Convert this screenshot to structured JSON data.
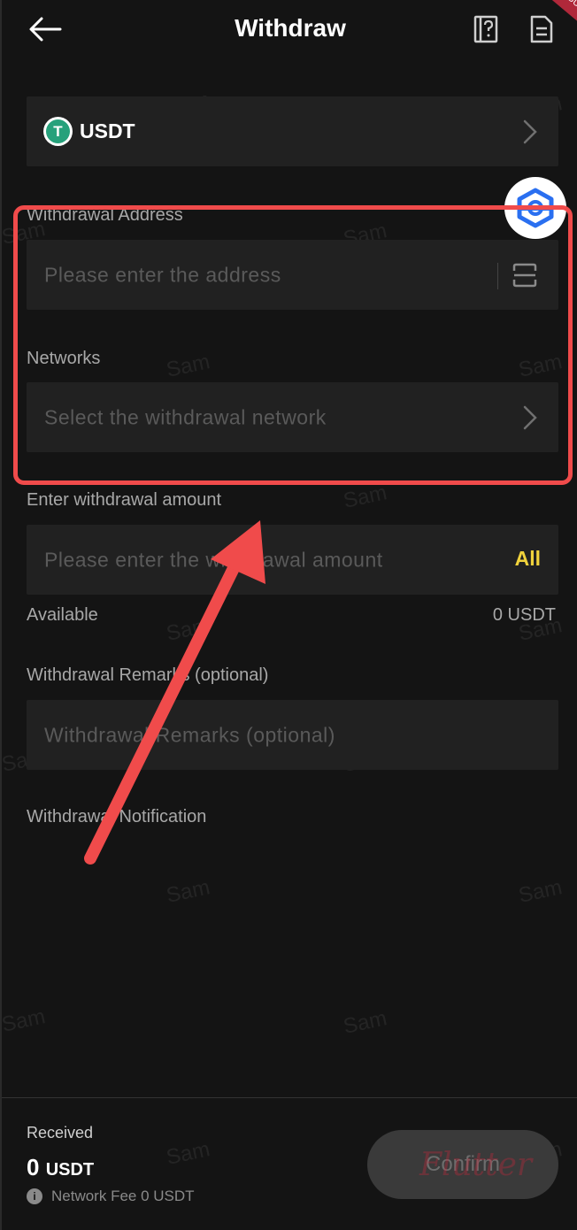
{
  "header": {
    "title": "Withdraw",
    "corner_tag": "DEBUG"
  },
  "coin": {
    "symbol": "T",
    "name": "USDT"
  },
  "address": {
    "label": "Withdrawal Address",
    "placeholder": "Please enter the address"
  },
  "network": {
    "label": "Networks",
    "placeholder": "Select the withdrawal network"
  },
  "amount": {
    "label": "Enter withdrawal amount",
    "placeholder": "Please enter the withdrawal amount",
    "all_label": "All",
    "available_label": "Available",
    "available_value": "0 USDT"
  },
  "remarks": {
    "label": "Withdrawal Remarks (optional)",
    "placeholder": "Withdrawal Remarks (optional)"
  },
  "notification": {
    "label": "Withdrawal Notification"
  },
  "footer": {
    "received_label": "Received",
    "received_amount": "0",
    "received_unit": "USDT",
    "fee_text": "Network Fee 0 USDT",
    "info_symbol": "i",
    "confirm_label": "Confirm",
    "framework_watermark": "Flutter"
  },
  "watermark": {
    "text": "Sam"
  },
  "colors": {
    "accent_yellow": "#f0d23c",
    "highlight_red": "#f04b4b",
    "usdt_green": "#26a17b"
  }
}
